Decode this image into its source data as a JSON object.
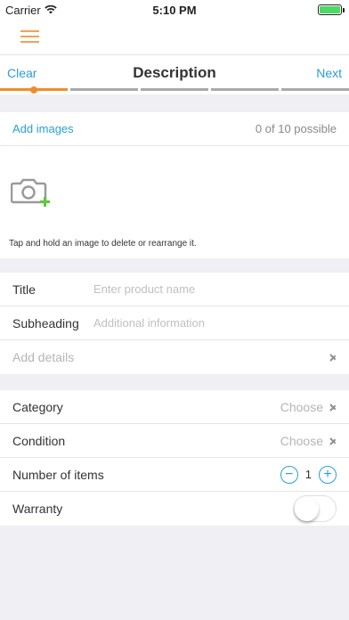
{
  "status_bar": {
    "carrier": "Carrier",
    "time": "5:10 PM"
  },
  "nav": {
    "clear_label": "Clear",
    "title": "Description",
    "next_label": "Next",
    "steps_total": 5,
    "active_step": 1
  },
  "images": {
    "add_label": "Add images",
    "count_text": "0 of 10 possible",
    "hint": "Tap and hold an image to delete or rearrange it."
  },
  "product": {
    "title_label": "Title",
    "title_placeholder": "Enter product name",
    "subheading_label": "Subheading",
    "subheading_placeholder": "Additional information",
    "details_label": "Add details"
  },
  "attributes": {
    "category_label": "Category",
    "category_value": "Choose",
    "condition_label": "Condition",
    "condition_value": "Choose",
    "items_label": "Number of items",
    "items_value": "1",
    "warranty_label": "Warranty",
    "warranty_on": false
  },
  "colors": {
    "accent": "#2a9fd6",
    "progress": "#f28c28",
    "menu": "#f2a15a",
    "add_badge": "#5cc83c"
  },
  "icons": [
    "wifi-icon",
    "battery-icon",
    "menu-icon",
    "camera-add-icon",
    "chevron-right-icon",
    "minus-icon",
    "plus-icon"
  ]
}
